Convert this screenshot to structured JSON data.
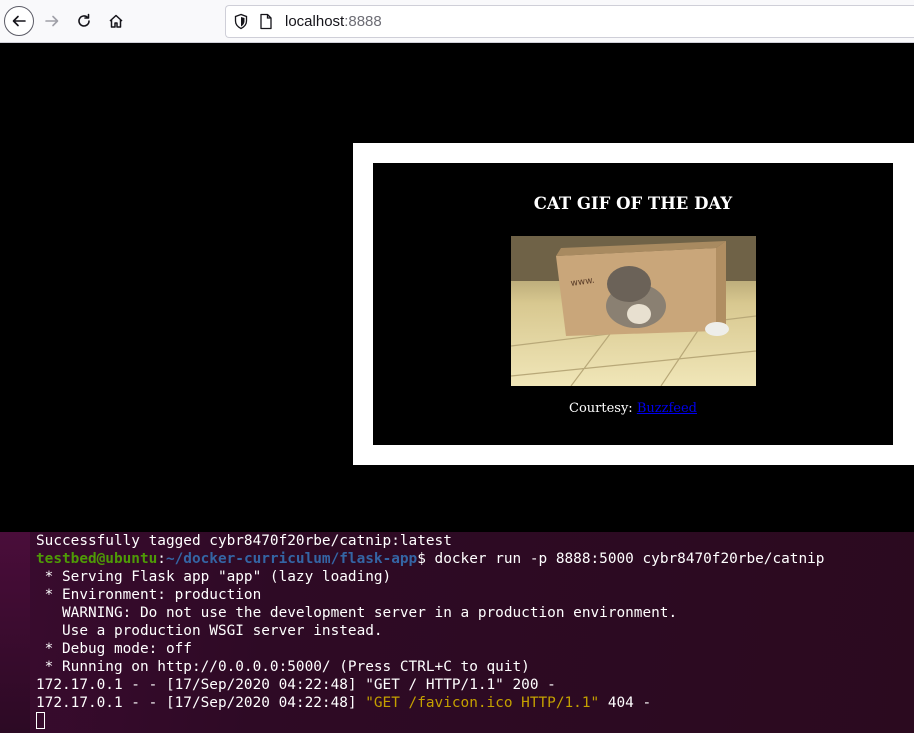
{
  "browser": {
    "url_host": "localhost",
    "url_port": ":8888"
  },
  "page": {
    "title": "CAT GIF OF THE DAY",
    "image_icon": "cat-in-box-image",
    "courtesy_label": "Courtesy:",
    "courtesy_link": "Buzzfeed"
  },
  "terminal": {
    "tagged_line": "Successfully tagged cybr8470f20rbe/catnip:latest",
    "prompt_user": "testbed@ubuntu",
    "prompt_sep": ":",
    "prompt_path": "~/docker-curriculum/flask-app",
    "prompt_command": "$ docker run -p 8888:5000 cybr8470f20rbe/catnip",
    "lines": [
      " * Serving Flask app \"app\" (lazy loading)",
      " * Environment: production",
      "   WARNING: Do not use the development server in a production environment.",
      "   Use a production WSGI server instead.",
      " * Debug mode: off",
      " * Running on http://0.0.0.0:5000/ (Press CTRL+C to quit)",
      "172.17.0.1 - - [17/Sep/2020 04:22:48] \"GET / HTTP/1.1\" 200 -"
    ],
    "last_log_prefix": "172.17.0.1 - - [17/Sep/2020 04:22:48] ",
    "last_log_request": "\"GET /favicon.ico HTTP/1.1\"",
    "last_log_suffix": " 404 -"
  }
}
